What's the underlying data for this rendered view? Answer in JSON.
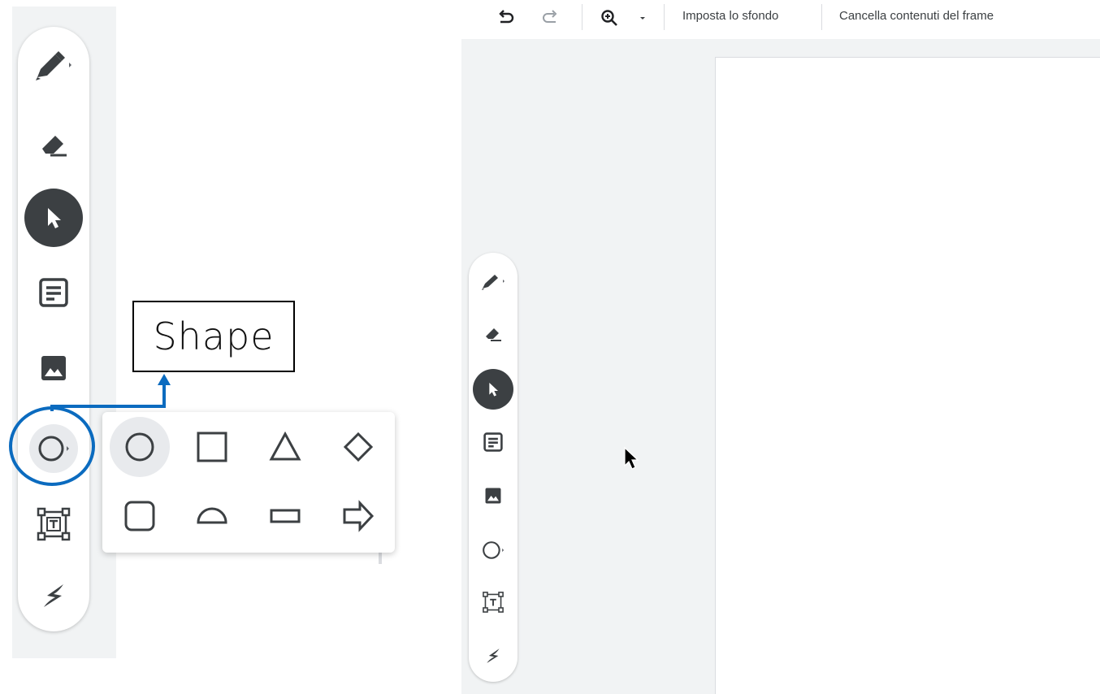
{
  "toolbar": {
    "undo_icon": "undo-icon",
    "redo_icon": "redo-icon",
    "zoom_icon": "zoom-in-icon",
    "zoom_dropdown_icon": "dropdown-arrow-icon",
    "set_background": "Imposta lo sfondo",
    "clear_frame": "Cancella contenuti del frame"
  },
  "callout": {
    "label": "Shape",
    "color": "#0b6bbf"
  },
  "side_toolbar": {
    "tools": [
      "pen-icon",
      "eraser-icon",
      "select-icon",
      "sticky-note-icon",
      "image-icon",
      "circle-shape-icon",
      "text-box-icon",
      "laser-pointer-icon"
    ],
    "active_tool": "select-icon",
    "active_color": "#3c4043"
  },
  "shape_menu": {
    "shapes": [
      "circle",
      "square",
      "triangle",
      "diamond",
      "rounded-square",
      "half-circle",
      "rectangle",
      "arrow"
    ],
    "selected": "circle"
  }
}
